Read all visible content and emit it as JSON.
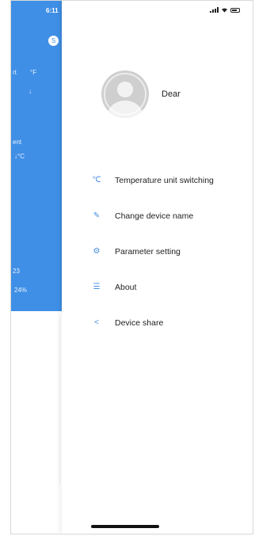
{
  "background_app": {
    "status_time": "6:11",
    "avatar_initial": "S",
    "text_a": "rt",
    "text_b": "°F",
    "text_c": "↓",
    "text_d": "ent",
    "text_e": "↓°C",
    "text_f": "23",
    "text_g": "24%",
    "accent_color": "#3f8fe6"
  },
  "drawer": {
    "user": {
      "name": "Dear"
    },
    "menu": [
      {
        "label": "Temperature unit switching",
        "icon": "temperature-switch-icon",
        "glyph": "℃"
      },
      {
        "label": "Change device name",
        "icon": "edit-icon",
        "glyph": "✎"
      },
      {
        "label": "Parameter setting",
        "icon": "gear-icon",
        "glyph": "⚙"
      },
      {
        "label": "About",
        "icon": "info-icon",
        "glyph": "☰"
      },
      {
        "label": "Device share",
        "icon": "share-icon",
        "glyph": "<"
      }
    ]
  }
}
